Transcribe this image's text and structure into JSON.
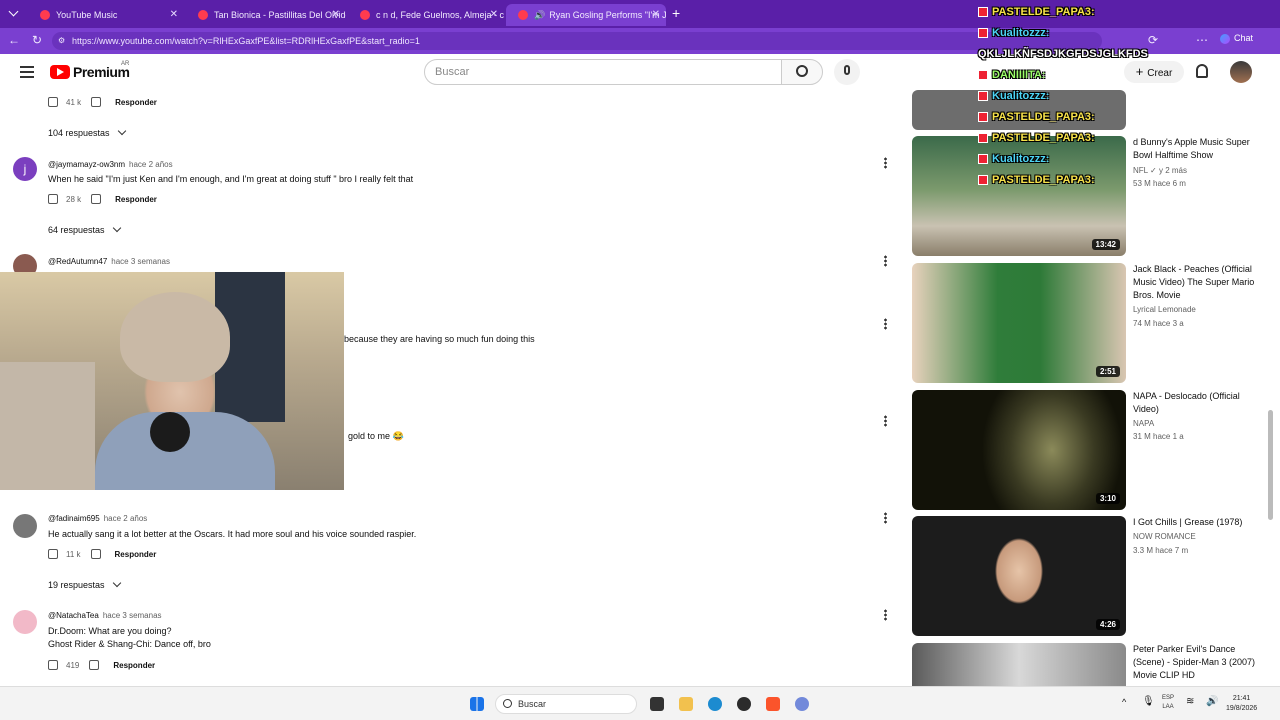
{
  "browser": {
    "tabs": [
      {
        "label": "YouTube Music"
      },
      {
        "label": "Tan Bionica - Pastillitas Del Olvido"
      },
      {
        "label": "c n d, Fede Guelmos, Almeja - cifr"
      },
      {
        "label": "Ryan Gosling Performs \"I'm Ju"
      }
    ],
    "url": "https://www.youtube.com/watch?v=RlHExGaxfPE&list=RDRlHExGaxfPE&start_radio=1",
    "chat_button": "Chat"
  },
  "header": {
    "logo": "Premium",
    "country": "AR",
    "search_placeholder": "Buscar",
    "create_label": "Crear"
  },
  "comments": [
    {
      "likes": "41 k",
      "reply": "Responder",
      "replies": "104 respuestas"
    },
    {
      "author": "@jaymamayz-ow3nm",
      "time": "hace 2 años",
      "text": "When he said \"I'm just Ken and I'm enough, and I'm great at doing stuff \" bro I really felt that",
      "likes": "28 k",
      "reply": "Responder",
      "replies": "64 respuestas",
      "avatar": "j"
    },
    {
      "author": "@RedAutumn47",
      "time": "hace 3 semanas"
    },
    {
      "text": "because they are having so much fun doing this"
    },
    {
      "text": "gold to me 😂"
    },
    {
      "author": "@fadinaim695",
      "time": "hace 2 años",
      "text": "He actually sang it a lot better at the Oscars. It had more soul and his voice sounded raspier.",
      "likes": "11 k",
      "reply": "Responder",
      "replies": "19 respuestas"
    },
    {
      "author": "@NatachaTea",
      "time": "hace 3 semanas",
      "text": "Dr.Doom: What are you doing?",
      "text2": "Ghost Rider & Shang-Chi: Dance off, bro",
      "likes": "419",
      "reply": "Responder"
    }
  ],
  "recommendations": [
    {
      "title": "d Bunny's Apple Music Super Bowl Halftime Show",
      "channel": "NFL",
      "meta": "53 M  hace 6 m",
      "duration": "13:42",
      "extra": "y 2 más"
    },
    {
      "title": "Jack Black - Peaches (Official Music Video) The Super Mario Bros. Movie",
      "channel": "Lyrical Lemonade",
      "meta": "74 M  hace 3 a",
      "duration": "2:51"
    },
    {
      "title": "NAPA - Deslocado (Official Video)",
      "channel": "NAPA",
      "meta": "31 M  hace 1 a",
      "duration": "3:10"
    },
    {
      "title": "I Got Chills | Grease (1978)",
      "channel": "NOW ROMANCE",
      "meta": "3.3 M  hace 7 m",
      "duration": "4:26"
    },
    {
      "title": "Peter Parker Evil's Dance (Scene) - Spider-Man 3 (2007) Movie CLIP HD",
      "channel": "",
      "meta": "",
      "duration": ""
    }
  ],
  "chat": [
    {
      "user": "PASTELDE_PAPA3:",
      "color": "#f6e14a"
    },
    {
      "user": "Kualitozzz:",
      "color": "#4cd4f5"
    },
    {
      "user": "QKLJLKÑFSDJKGFDSJGLKFDS",
      "color": "#ffffff"
    },
    {
      "user": "DANIIIITA:",
      "color": "#9cff6a"
    },
    {
      "user": "Kualitozzz:",
      "color": "#4cd4f5"
    },
    {
      "user": "PASTELDE_PAPA3:",
      "color": "#f6e14a"
    },
    {
      "user": "PASTELDE_PAPA3:",
      "color": "#f6e14a"
    },
    {
      "user": "Kualitozzz:",
      "color": "#4cd4f5"
    },
    {
      "user": "PASTELDE_PAPA3:",
      "color": "#f6e14a"
    }
  ],
  "taskbar": {
    "search": "Buscar",
    "lang": "ESP",
    "lang2": "LAA",
    "time": "21:41",
    "date": "19/8/2026"
  }
}
